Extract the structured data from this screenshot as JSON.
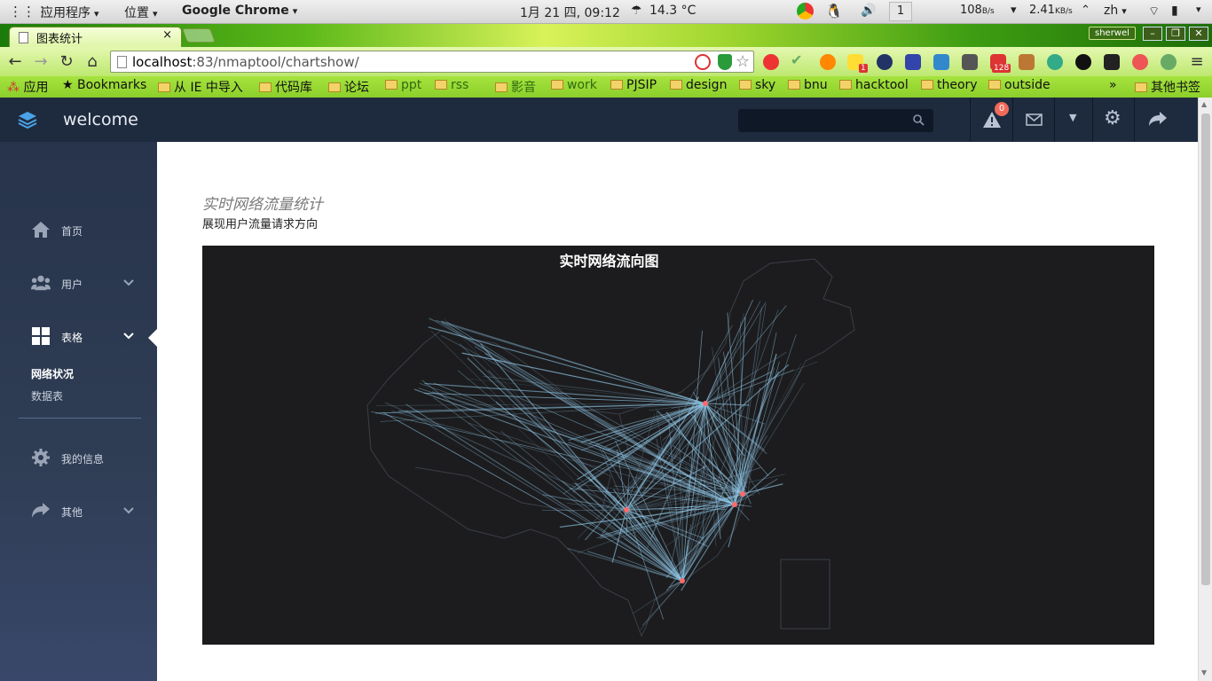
{
  "system_panel": {
    "apps_menu": "应用程序",
    "places_menu": "位置",
    "active_app": "Google Chrome",
    "clock": "1月 21 四, 09:12",
    "weather": "14.3 °C",
    "workspace": "1",
    "net_down": "108",
    "net_down_unit": "B/s",
    "net_up": "2.41",
    "net_up_unit": "KB/s",
    "input_method": "zh"
  },
  "browser": {
    "tab_title": "图表统计",
    "tab_close": "×",
    "profile": "sherwel",
    "url_host": "localhost",
    "url_rest": ":83/nmaptool/chartshow/",
    "extension_badge": "128",
    "extension_badge_small": "1",
    "bookmarks": [
      "应用",
      "Bookmarks",
      "从 IE 中导入",
      "代码库",
      "论坛",
      "ppt",
      "rss",
      "影音",
      "work",
      "PJSIP",
      "design",
      "sky",
      "bnu",
      "hacktool",
      "theory",
      "outside"
    ],
    "bookmarks_overflow": "»",
    "other_bookmarks": "其他书签"
  },
  "app": {
    "brand": "welcome",
    "search_placeholder": "",
    "notification_count": "0"
  },
  "sidebar": {
    "items": [
      {
        "label": "首页",
        "icon": "home-icon"
      },
      {
        "label": "用户",
        "icon": "users-icon"
      },
      {
        "label": "表格",
        "icon": "grid-icon"
      },
      {
        "label": "我的信息",
        "icon": "gear-icon"
      },
      {
        "label": "其他",
        "icon": "share-icon"
      }
    ],
    "sub_items": [
      "网络状况",
      "数据表"
    ]
  },
  "main": {
    "title": "实时网络流量统计",
    "subtitle": "展现用户流量请求方向"
  },
  "chart_data": {
    "type": "map-flow",
    "title": "实时网络流向图",
    "hubs": [
      "Beijing",
      "Shanghai",
      "Hangzhou",
      "Guangzhou",
      "Chengdu"
    ],
    "colors": {
      "background": "#1c1c1e",
      "line": "#8fc6e6",
      "hub": "#ff6a6a",
      "outline": "#3a3f48"
    }
  }
}
